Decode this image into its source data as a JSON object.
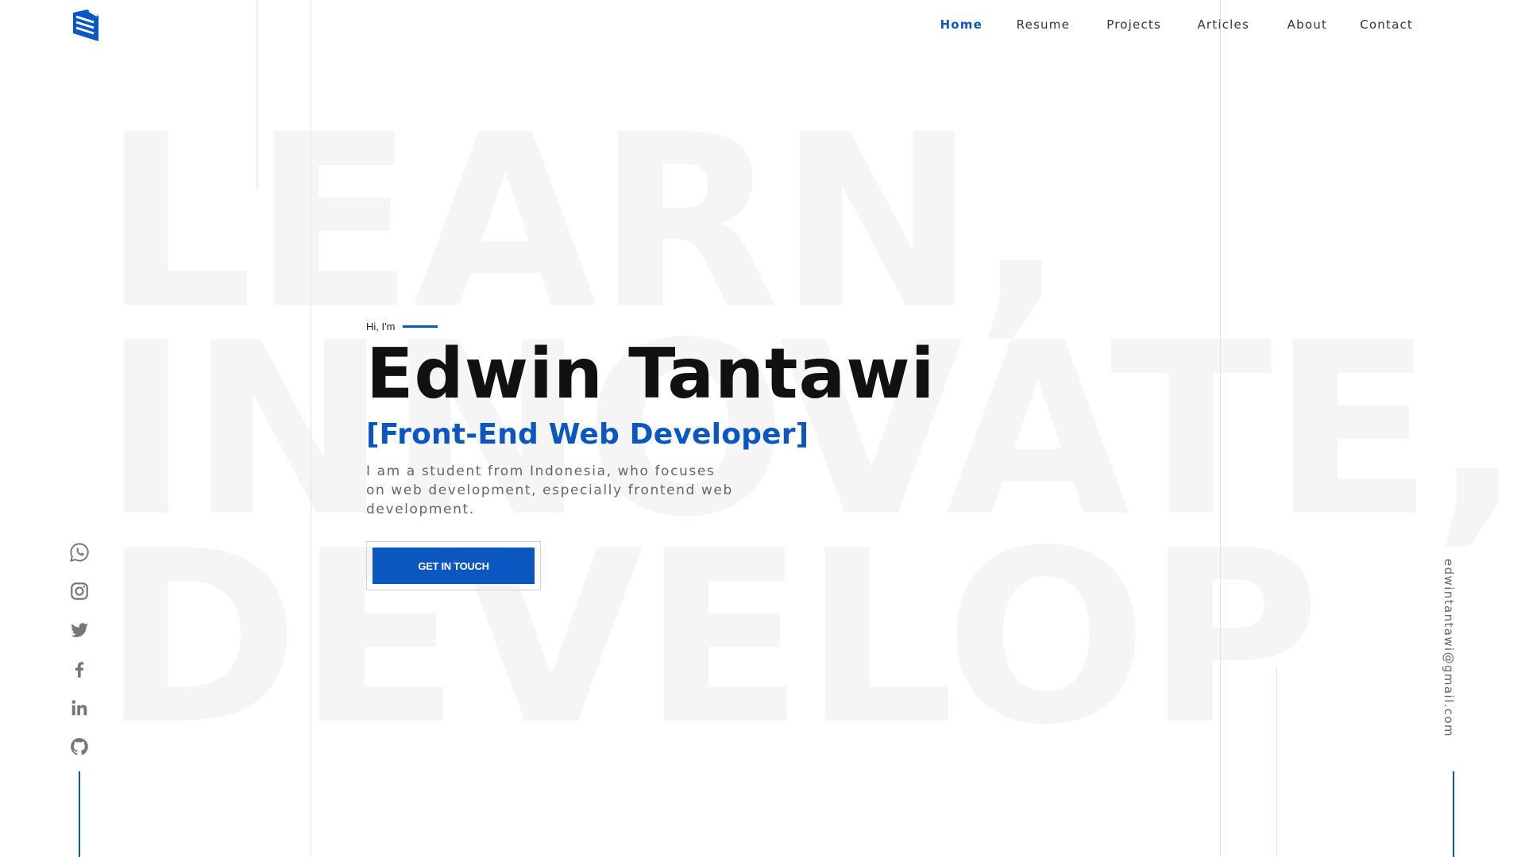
{
  "brand": {
    "logo_icon": "stacked-pages-logo-icon",
    "accent_color": "#0a57c2"
  },
  "nav": {
    "items": [
      {
        "label": "Home",
        "active": true
      },
      {
        "label": "Resume",
        "active": false
      },
      {
        "label": "Projects",
        "active": false
      },
      {
        "label": "Articles",
        "active": false
      },
      {
        "label": "About",
        "active": false
      },
      {
        "label": "Contact",
        "active": false
      }
    ]
  },
  "background": {
    "lines": [
      "LEARN,",
      "INNOVATE,",
      "DEVELOP"
    ]
  },
  "hero": {
    "greeting": "Hi, I'm",
    "name": "Edwin Tantawi",
    "role": "[Front-End Web Developer]",
    "description": "I am a student from Indonesia, who focuses on web development, especially frontend web development.",
    "cta_label": "GET IN TOUCH"
  },
  "socials": [
    {
      "icon": "whatsapp-icon"
    },
    {
      "icon": "instagram-icon"
    },
    {
      "icon": "twitter-icon"
    },
    {
      "icon": "facebook-icon"
    },
    {
      "icon": "linkedin-icon"
    },
    {
      "icon": "github-icon"
    }
  ],
  "contact": {
    "email": "edwintantawi@gmail.com"
  }
}
